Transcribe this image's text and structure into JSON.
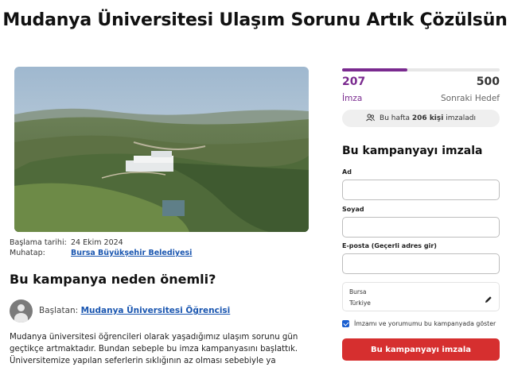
{
  "page": {
    "title": "Mudanya Üniversitesi Ulaşım Sorunu Artık Çözülsün"
  },
  "details": {
    "start_label": "Başlama tarihi:",
    "start_value": "24 Ekim 2024",
    "target_label": "Muhatap:",
    "target_value": "Bursa Büyükşehir Belediyesi"
  },
  "why": {
    "heading": "Bu kampanya neden önemli?",
    "starter_prefix": "Başlatan:",
    "starter_name": "Mudanya Üniversitesi Öğrencisi",
    "description": "Mudanya üniversitesi öğrencileri olarak yaşadığımız ulaşım sorunu gün geçtikçe artmaktadır. Bundan sebeple bu imza kampanyasını başlattık. Üniversitemize yapılan seferlerin sıklığının az olması sebebiyle ya doluluktan"
  },
  "stats": {
    "signatures": "207",
    "signatures_label": "İmza",
    "next_goal": "500",
    "next_goal_label": "Sonraki Hedef",
    "progress_fraction": 0.414,
    "weekly_prefix": "Bu hafta",
    "weekly_count": "206 kişi",
    "weekly_suffix": "imzaladı"
  },
  "form": {
    "title": "Bu kampanyayı imzala",
    "first_name_label": "Ad",
    "last_name_label": "Soyad",
    "email_label": "E-posta (Geçerli adres gir)",
    "city": "Bursa",
    "country": "Türkiye",
    "consent_label": "İmzamı ve yorumumu bu kampanyada göster",
    "submit_label": "Bu kampanyayı imzala"
  },
  "icons": {
    "weekly": "people-icon",
    "edit": "pencil-icon"
  },
  "colors": {
    "accent_purple": "#7a2a8f",
    "submit_red": "#d62f2f",
    "link_blue": "#1a56b0",
    "checkbox_blue": "#1a5fd1"
  }
}
